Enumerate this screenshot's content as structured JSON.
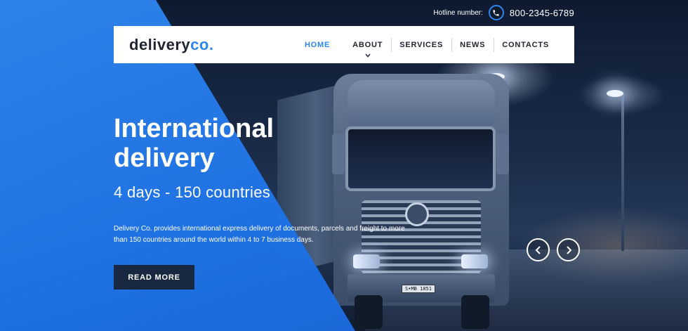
{
  "brand": {
    "name_main": "delivery",
    "name_accent": "co."
  },
  "hotline": {
    "label": "Hotline number:",
    "number": "800-2345-6789",
    "icon": "phone-icon"
  },
  "nav": {
    "items": [
      {
        "label": "HOME",
        "active": true
      },
      {
        "label": "ABOUT",
        "has_dropdown": true
      },
      {
        "label": "SERVICES"
      },
      {
        "label": "NEWS"
      },
      {
        "label": "CONTACTS"
      }
    ],
    "dropdown_icon": "chevron-down-icon"
  },
  "hero": {
    "headline_line1": "International",
    "headline_line2": "delivery",
    "subheadline": "4 days - 150 countries",
    "description": "Delivery Co. provides international express delivery of documents, parcels and freight to more than 150 countries around the world within 4 to 7 business days.",
    "cta_label": "READ MORE",
    "truck_plate": "S•MB 1851"
  },
  "slider": {
    "prev_icon": "chevron-left-icon",
    "next_icon": "chevron-right-icon"
  },
  "colors": {
    "accent": "#2f86ee",
    "dark": "#182840",
    "text_dark": "#1f2430",
    "white": "#ffffff"
  }
}
